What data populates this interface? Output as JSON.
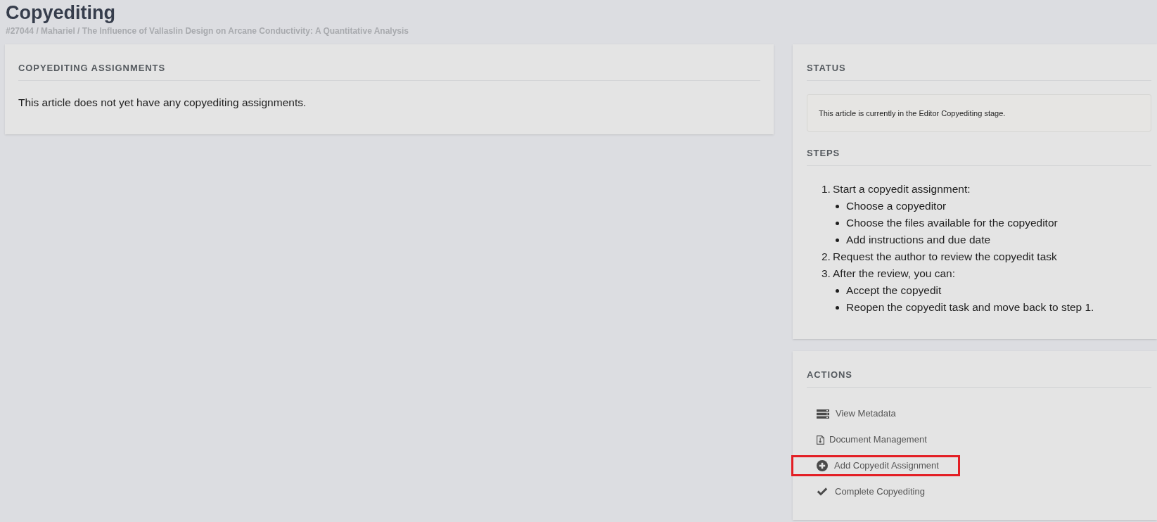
{
  "page": {
    "title": "Copyediting",
    "breadcrumb": "#27044 / Mahariel / The Influence of Vallaslin Design on Arcane Conductivity: A Quantitative Analysis"
  },
  "assignments_panel": {
    "heading": "COPYEDITING ASSIGNMENTS",
    "message": "This article does not yet have any copyediting assignments."
  },
  "status_panel": {
    "heading": "STATUS",
    "notice": "This article is currently in the Editor Copyediting stage.",
    "steps_heading": "STEPS",
    "steps": [
      {
        "number": "1.",
        "text": "Start a copyedit assignment:",
        "children": [
          {
            "text": "Choose a copyeditor"
          },
          {
            "text": "Choose the files available for the copyeditor"
          },
          {
            "text": "Add instructions and due date"
          }
        ]
      },
      {
        "number": "2.",
        "text": "Request the author to review the copyedit task"
      },
      {
        "number": "3.",
        "text": "After the review, you can:",
        "children": [
          {
            "text": "Accept the copyedit"
          },
          {
            "text": "Reopen the copyedit task and move back to step 1."
          }
        ]
      }
    ]
  },
  "actions_panel": {
    "heading": "ACTIONS",
    "actions": [
      {
        "kind": "metadata",
        "label": "View Metadata",
        "highlighted": false
      },
      {
        "kind": "documents",
        "label": "Document Management",
        "highlighted": false
      },
      {
        "kind": "add",
        "label": "Add Copyedit Assignment",
        "highlighted": true
      },
      {
        "kind": "complete",
        "label": "Complete Copyediting",
        "highlighted": false
      }
    ]
  }
}
